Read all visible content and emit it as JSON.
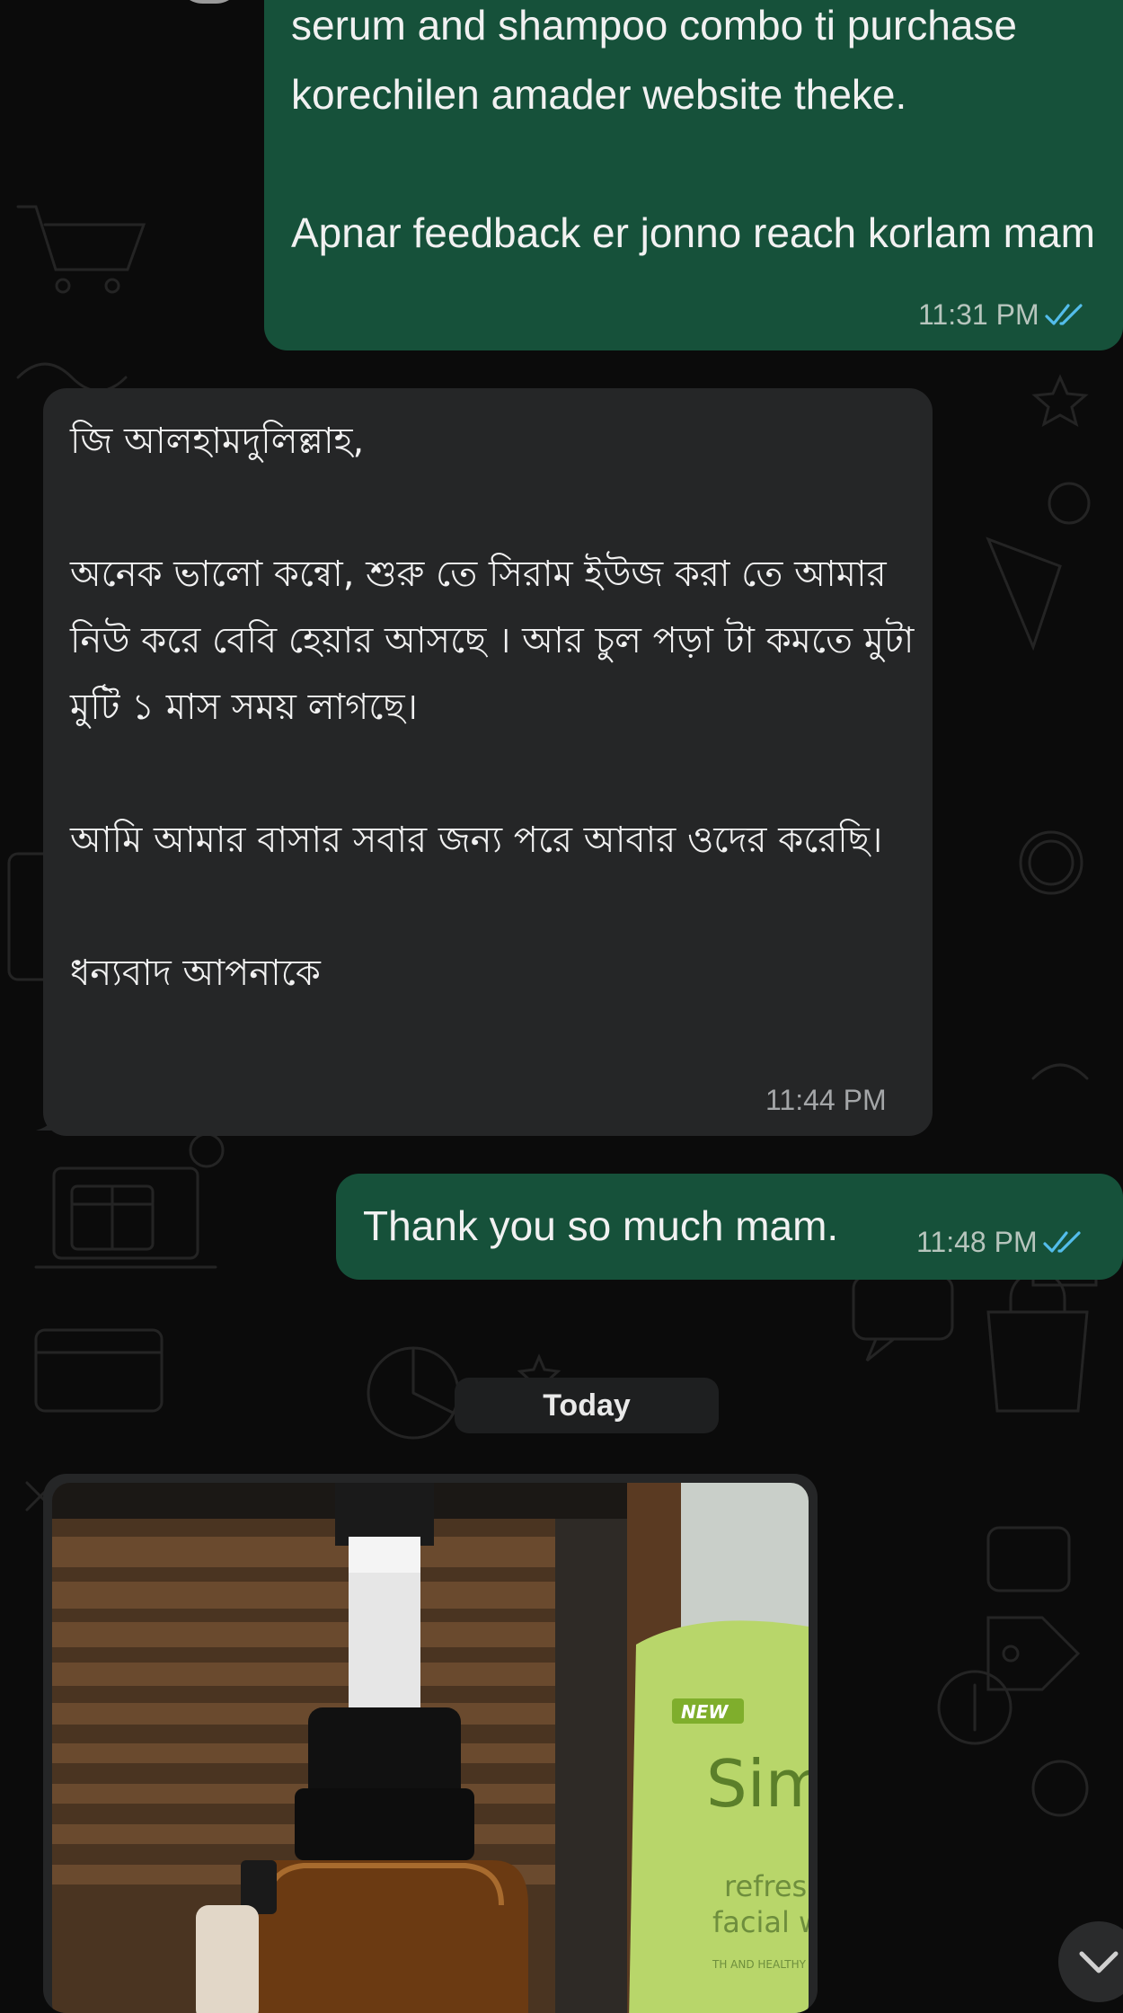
{
  "chat": {
    "messages": [
      {
        "direction": "outgoing",
        "text": "serum and shampoo combo ti purchase korechilen amader website theke.\n\nApnar feedback er jonno reach korlam mam",
        "time": "11:31 PM",
        "status": "read"
      },
      {
        "direction": "incoming",
        "text": "জি আলহামদুলিল্লাহ,\n\nঅনেক ভালো কন্বো, শুরু তে সিরাম ইউজ করা তে আমার নিউ করে বেবি হেয়ার আসছে । আর চুল পড়া টা কমতে মুটা মুটি ১ মাস সময় লাগছে।\n\nআমি আমার বাসার সবার জন্য পরে আবার ওদের করেছি।\n\nধন্যবাদ আপনাকে",
        "time": "11:44 PM"
      },
      {
        "direction": "outgoing",
        "text": "Thank you so much mam.",
        "time": "11:48 PM",
        "status": "read"
      }
    ],
    "date_separator": "Today",
    "media_message": {
      "type": "photo",
      "visible_product_text": [
        "NEW",
        "Sim",
        "refresh",
        "facial w",
        "TH AND HEALTHY"
      ]
    }
  },
  "colors": {
    "background": "#0b0b0b",
    "outgoing_bubble": "#16513a",
    "incoming_bubble": "#252627",
    "read_ticks": "#53bdeb"
  },
  "icons": [
    "double-check-icon",
    "chevron-down-icon"
  ]
}
